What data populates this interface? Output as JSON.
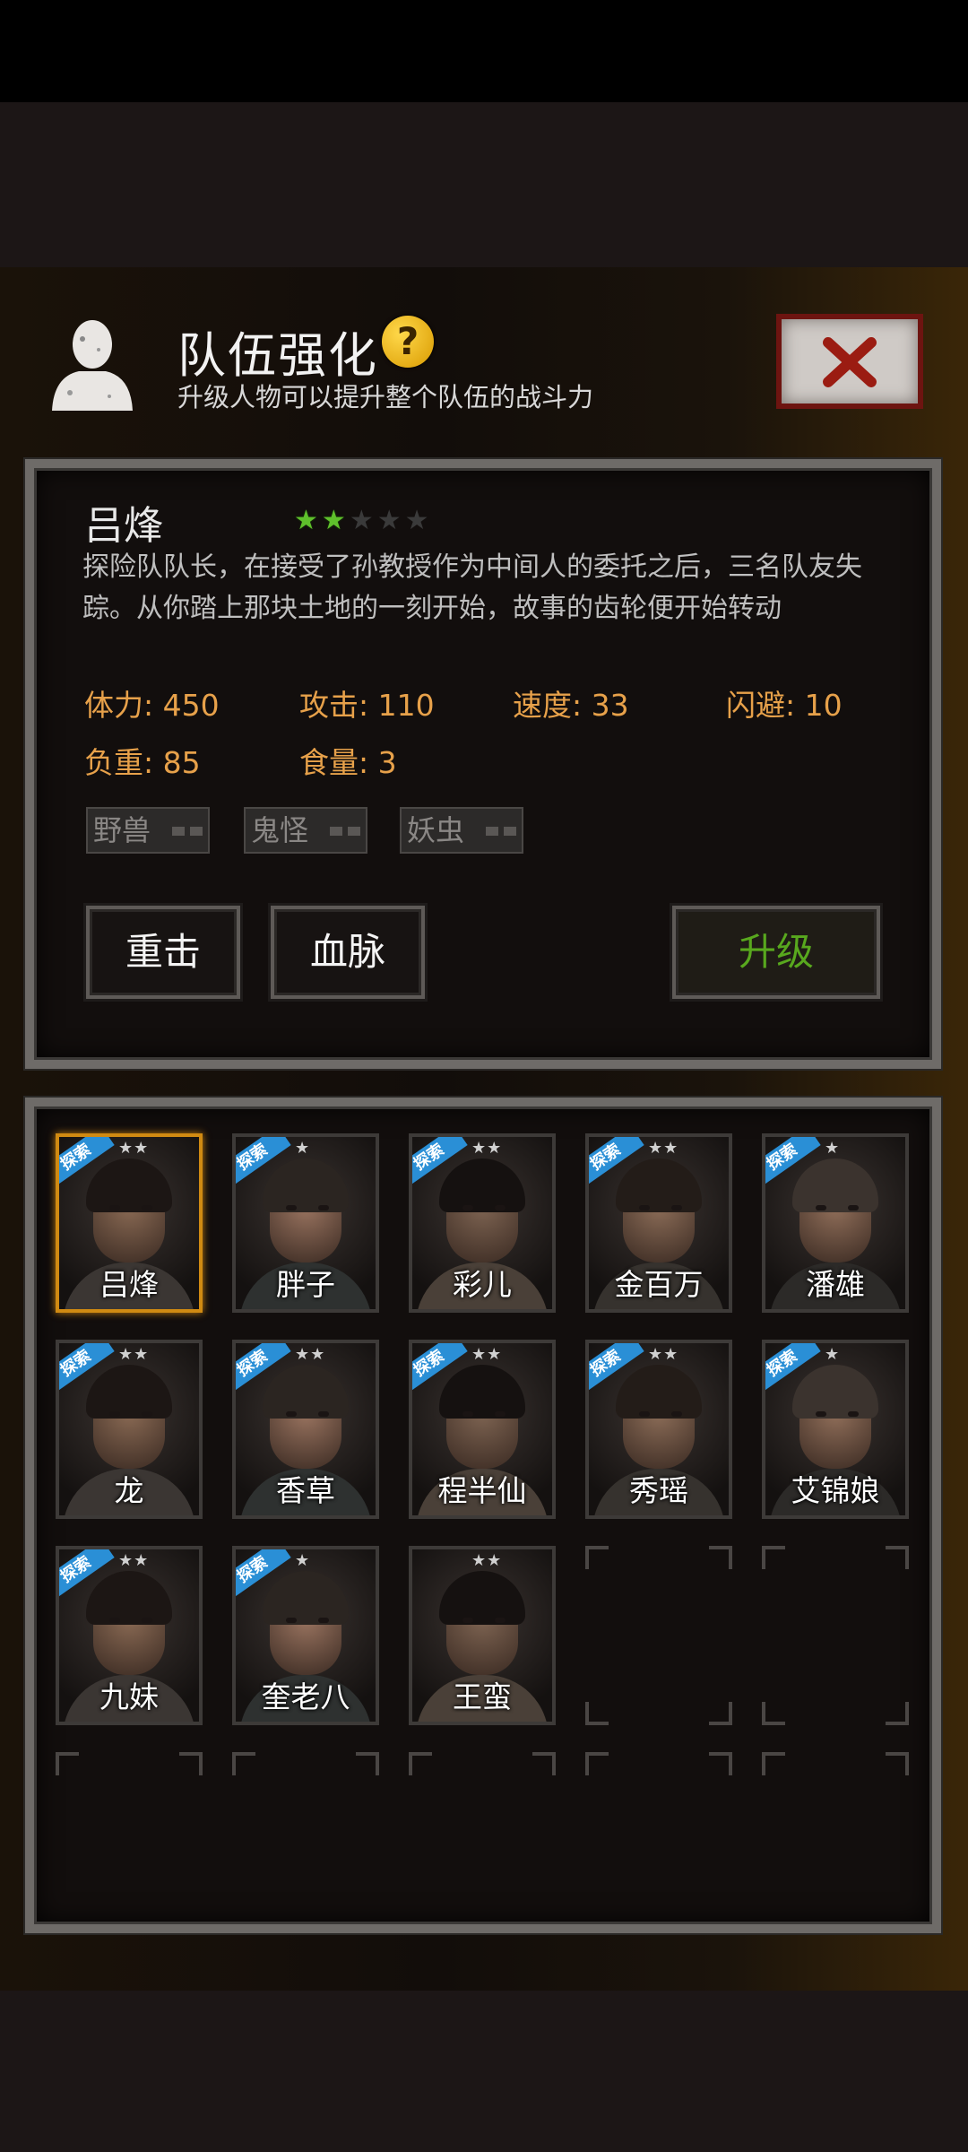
{
  "header": {
    "title": "队伍强化",
    "help_icon": "?",
    "subtitle": "升级人物可以提升整个队伍的战斗力"
  },
  "character": {
    "name": "吕烽",
    "stars": {
      "filled": 2,
      "total": 5
    },
    "description": "探险队队长，在接受了孙教授作为中间人的委托之后，三名队友失踪。从你踏上那块土地的一刻开始，故事的齿轮便开始转动",
    "stats": [
      {
        "label": "体力",
        "value": "450"
      },
      {
        "label": "攻击",
        "value": "110"
      },
      {
        "label": "速度",
        "value": "33"
      },
      {
        "label": "闪避",
        "value": "10"
      },
      {
        "label": "负重",
        "value": "85"
      },
      {
        "label": "食量",
        "value": "3"
      }
    ],
    "tags": [
      "野兽",
      "鬼怪",
      "妖虫"
    ]
  },
  "buttons": {
    "heavy_strike": "重击",
    "bloodline": "血脉",
    "upgrade": "升级"
  },
  "roster": [
    {
      "name": "吕烽",
      "badge": "探索",
      "stars": "★★",
      "selected": true
    },
    {
      "name": "胖子",
      "badge": "探索",
      "stars": "★",
      "selected": false
    },
    {
      "name": "彩儿",
      "badge": "探索",
      "stars": "★★",
      "selected": false
    },
    {
      "name": "金百万",
      "badge": "探索",
      "stars": "★★",
      "selected": false
    },
    {
      "name": "潘雄",
      "badge": "探索",
      "stars": "★",
      "selected": false
    },
    {
      "name": "龙",
      "badge": "探索",
      "stars": "★★",
      "selected": false
    },
    {
      "name": "香草",
      "badge": "探索",
      "stars": "★★",
      "selected": false
    },
    {
      "name": "程半仙",
      "badge": "探索",
      "stars": "★★",
      "selected": false
    },
    {
      "name": "秀瑶",
      "badge": "探索",
      "stars": "★★",
      "selected": false
    },
    {
      "name": "艾锦娘",
      "badge": "探索",
      "stars": "★",
      "selected": false
    },
    {
      "name": "九妹",
      "badge": "探索",
      "stars": "★★",
      "selected": false
    },
    {
      "name": "奎老八",
      "badge": "探索",
      "stars": "★",
      "selected": false
    },
    {
      "name": "王蛮",
      "badge": "",
      "stars": "★★",
      "selected": false
    }
  ],
  "colors": {
    "stat_text": "#e7a14a",
    "upgrade_text": "#58a81e",
    "star_filled": "#5fc02c",
    "selected_border": "#d08a12",
    "badge_blue": "#2a8fd6"
  }
}
